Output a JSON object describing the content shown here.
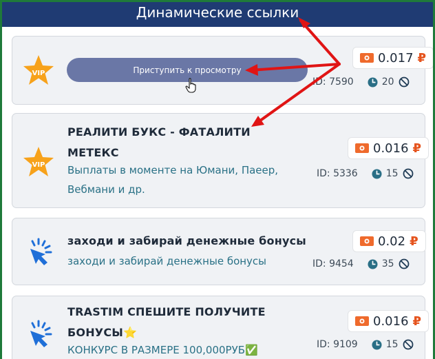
{
  "header": {
    "title": "Динамические ссылки"
  },
  "colors": {
    "accent": "#1f3b73",
    "rub": "#e5541e",
    "annotation_arrow": "#e01414",
    "frame": "#1f7a3a"
  },
  "cards": [
    {
      "icon": "vip-star-icon",
      "button_label": "Приступить к просмотру",
      "price_value": "0.017",
      "currency": "₽",
      "id_label": "ID: 7590",
      "timer": "20"
    },
    {
      "icon": "vip-star-icon",
      "title_line1": "РЕАЛИТИ БУКС - ФАТАЛИТИ",
      "title_line2": "МЕТЕКС",
      "desc_line1": "Выплаты в моменте на Юмани, Паеер,",
      "desc_line2": "Вебмани и др.",
      "price_value": "0.016",
      "currency": "₽",
      "id_label": "ID: 5336",
      "timer": "15"
    },
    {
      "icon": "click-cursor-icon",
      "title_line1": "заходи и забирай денежные бонусы",
      "desc_line1": "заходи и забирай денежные бонусы",
      "price_value": "0.02",
      "currency": "₽",
      "id_label": "ID: 9454",
      "timer": "35"
    },
    {
      "icon": "click-cursor-icon",
      "title_line1": "TRASTIM СПЕШИТЕ ПОЛУЧИТЕ",
      "title_line2": "БОНУСЫ",
      "title_emoji": "⭐",
      "desc_line1": "КОНКУРС В РАЗМЕРЕ 100,000РУБ",
      "desc_emoji": "✅",
      "price_value": "0.016",
      "currency": "₽",
      "id_label": "ID: 9109",
      "timer": "15"
    }
  ]
}
